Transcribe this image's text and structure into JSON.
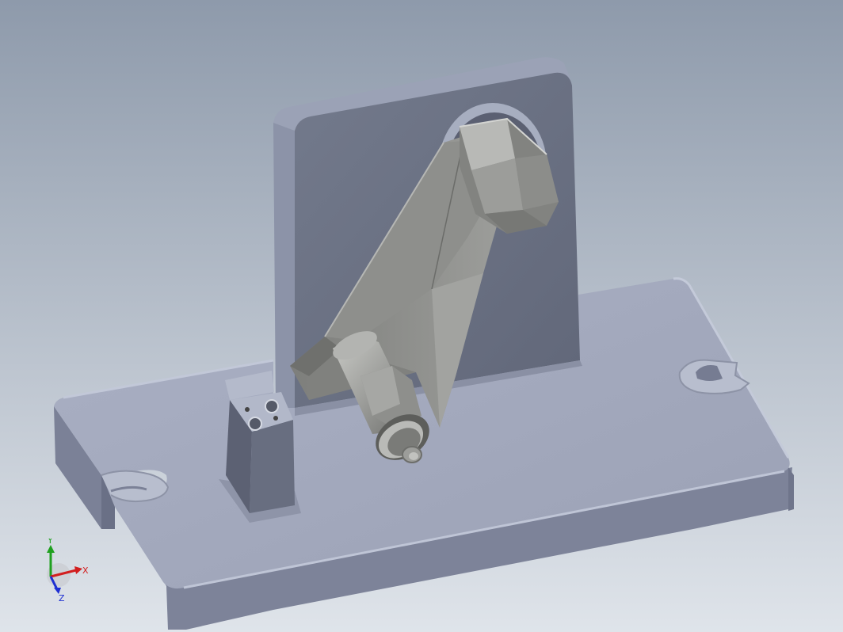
{
  "viewport": {
    "background_top": "#8e9aab",
    "background_bottom": "#dfe4ea"
  },
  "model": {
    "parts": [
      "base-plate",
      "vertical-plate",
      "clamp-arm",
      "hex-bolt",
      "threaded-pin",
      "locating-block"
    ],
    "colors": {
      "plate_top": "#a3a9be",
      "plate_side": "#7e849a",
      "plate_dark": "#5f6476",
      "vertical_face": "#6c7283",
      "arm_light": "#a4a5a2",
      "arm_mid": "#8a8b88",
      "arm_dark": "#6a6b69"
    }
  },
  "triad": {
    "x_label": "X",
    "y_label": "Y",
    "z_label": "Z",
    "x_color": "#d21e1e",
    "y_color": "#1fa01f",
    "z_color": "#1e2fd2"
  }
}
